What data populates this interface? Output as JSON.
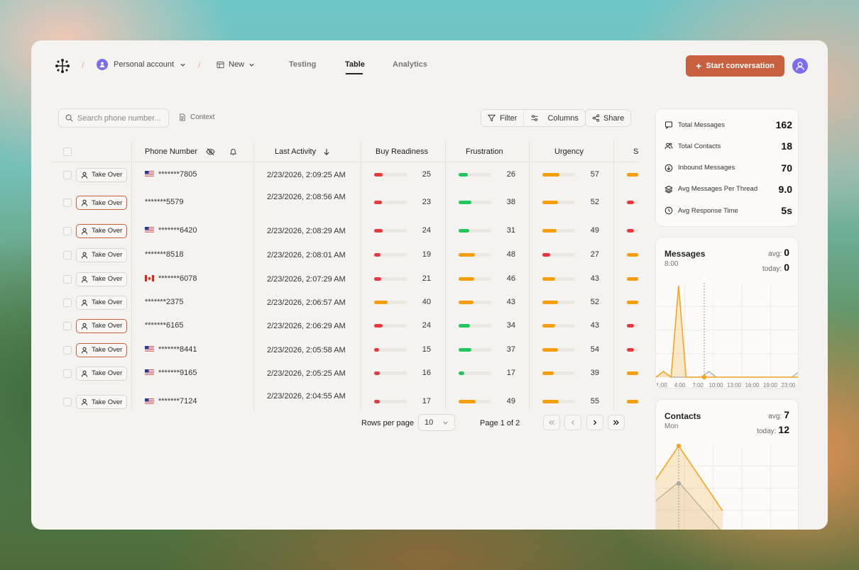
{
  "header": {
    "account_label": "Personal account",
    "new_label": "New",
    "tabs": [
      "Testing",
      "Table",
      "Analytics"
    ],
    "active_tab": "Table",
    "start_button": "Start conversation"
  },
  "toolbar": {
    "search_placeholder": "Search phone number...",
    "context_label": "Context",
    "filter_label": "Filter",
    "columns_label": "Columns",
    "share_label": "Share"
  },
  "table": {
    "columns": [
      "Phone Number",
      "Last Activity",
      "Buy Readiness",
      "Frustration",
      "Urgency",
      "Sa"
    ],
    "takeover_label": "Take Over",
    "rows": [
      {
        "flag": "us",
        "phone": "*******7805",
        "activity": "2/23/2026, 2:09:25 AM",
        "buy": 25,
        "frus": 26,
        "urg": 57,
        "sa": "orange",
        "active": false
      },
      {
        "flag": "",
        "phone": "*******5579",
        "activity": "2/23/2026, 2:08:56 AM",
        "buy": 23,
        "frus": 38,
        "urg": 52,
        "sa": "red",
        "active": true
      },
      {
        "flag": "us",
        "phone": "*******6420",
        "activity": "2/23/2026, 2:08:29 AM",
        "buy": 24,
        "frus": 31,
        "urg": 49,
        "sa": "red",
        "active": true
      },
      {
        "flag": "",
        "phone": "*******8518",
        "activity": "2/23/2026, 2:08:01 AM",
        "buy": 19,
        "frus": 48,
        "urg": 27,
        "sa": "orange",
        "active": false
      },
      {
        "flag": "ca",
        "phone": "*******6078",
        "activity": "2/23/2026, 2:07:29 AM",
        "buy": 21,
        "frus": 46,
        "urg": 43,
        "sa": "orange",
        "active": false
      },
      {
        "flag": "",
        "phone": "*******2375",
        "activity": "2/23/2026, 2:06:57 AM",
        "buy": 40,
        "frus": 43,
        "urg": 52,
        "sa": "orange",
        "active": false
      },
      {
        "flag": "",
        "phone": "*******6165",
        "activity": "2/23/2026, 2:06:29 AM",
        "buy": 24,
        "frus": 34,
        "urg": 43,
        "sa": "red",
        "active": true
      },
      {
        "flag": "us",
        "phone": "*******8441",
        "activity": "2/23/2026, 2:05:58 AM",
        "buy": 15,
        "frus": 37,
        "urg": 54,
        "sa": "red",
        "active": true
      },
      {
        "flag": "us",
        "phone": "*******9165",
        "activity": "2/23/2026, 2:05:25 AM",
        "buy": 16,
        "frus": 17,
        "urg": 39,
        "sa": "orange",
        "active": false
      },
      {
        "flag": "us",
        "phone": "*******7124",
        "activity": "2/23/2026, 2:04:55 AM",
        "buy": 17,
        "frus": 49,
        "urg": 55,
        "sa": "orange",
        "active": false
      }
    ]
  },
  "pagination": {
    "rows_per_page_label": "Rows per page",
    "rows_per_page_value": "10",
    "page_label": "Page 1 of 2"
  },
  "stats": [
    {
      "icon": "message-icon",
      "label": "Total Messages",
      "value": "162"
    },
    {
      "icon": "users-icon",
      "label": "Total Contacts",
      "value": "18"
    },
    {
      "icon": "inbound-icon",
      "label": "Inbound Messages",
      "value": "70"
    },
    {
      "icon": "layers-icon",
      "label": "Avg Messages Per Thread",
      "value": "9.0"
    },
    {
      "icon": "clock-icon",
      "label": "Avg Response Time",
      "value": "5s"
    }
  ],
  "messages_card": {
    "title": "Messages",
    "subtitle": "8:00",
    "avg_label": "avg:",
    "avg_value": "0",
    "today_label": "today:",
    "today_value": "0"
  },
  "contacts_card": {
    "title": "Contacts",
    "subtitle": "Mon",
    "avg_label": "avg:",
    "avg_value": "7",
    "today_label": "today:",
    "today_value": "12"
  },
  "chart_data": [
    {
      "type": "area",
      "title": "Messages",
      "x": [
        "1:00",
        "4:00",
        "7:00",
        "10:00",
        "13:00",
        "16:00",
        "19:00",
        "23:00"
      ],
      "series": [
        {
          "values": [
            0,
            1,
            0,
            16,
            0,
            0,
            0,
            0,
            0,
            0,
            0,
            0,
            0,
            0,
            0,
            0,
            0,
            0,
            0,
            0
          ]
        },
        {
          "values": [
            0,
            1,
            0,
            0,
            0,
            0,
            0,
            1,
            0,
            0,
            0,
            0,
            0,
            0,
            0,
            0,
            0,
            0,
            0,
            1
          ]
        }
      ],
      "colors": [
        "#f5a623",
        "#aaaaaa"
      ],
      "grid": true
    },
    {
      "type": "area",
      "title": "Contacts",
      "series": [
        {
          "values": [
            3,
            12,
            3
          ]
        },
        {
          "values": [
            2,
            7,
            0
          ]
        }
      ],
      "colors": [
        "#f5a623",
        "#aaaaaa"
      ],
      "grid": true
    }
  ],
  "colors": {
    "accent": "#c8603f",
    "red": "#e8373d",
    "orange": "#f59e0b",
    "green": "#22c55e"
  }
}
